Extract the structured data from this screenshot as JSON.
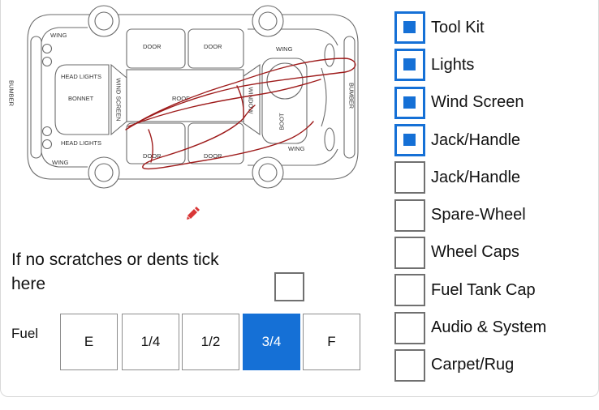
{
  "car_diagram": {
    "labels": {
      "bumper_front": "BUMBER",
      "bumper_rear": "BUMBER",
      "wing_front_top": "WING",
      "wing_front_bottom": "WING",
      "wing_rear_top": "WING",
      "wing_rear_bottom": "WING",
      "head_lights_top": "HEAD LIGHTS",
      "head_lights_bottom": "HEAD LIGHTS",
      "bonnet": "BONNET",
      "wind_screen": "WIND SCREEN",
      "door_front_top": "DOOR",
      "door_rear_top": "DOOR",
      "door_front_bottom": "DOOR",
      "door_rear_bottom": "DOOR",
      "roof": "ROOF",
      "window": "WINDOW",
      "boot": "BOOT"
    }
  },
  "toolbar": {
    "edit_icon": "pencil-icon"
  },
  "no_damage": {
    "label": "If no scratches or dents tick here",
    "checked": false
  },
  "fuel": {
    "label": "Fuel",
    "options": [
      "E",
      "1/4",
      "1/2",
      "3/4",
      "F"
    ],
    "selected": "3/4"
  },
  "checklist": {
    "items": [
      {
        "label": "Tool Kit",
        "checked": true
      },
      {
        "label": "Lights",
        "checked": true
      },
      {
        "label": "Wind Screen",
        "checked": true
      },
      {
        "label": "Jack/Handle",
        "checked": true
      },
      {
        "label": "Jack/Handle",
        "checked": false
      },
      {
        "label": "Spare-Wheel",
        "checked": false
      },
      {
        "label": "Wheel Caps",
        "checked": false
      },
      {
        "label": "Fuel Tank Cap",
        "checked": false
      },
      {
        "label": "Audio & System",
        "checked": false
      },
      {
        "label": "Carpet/Rug",
        "checked": false
      }
    ]
  },
  "colors": {
    "accent": "#1570d6",
    "marking": "#9e1b1b",
    "edit_icon": "#d93636",
    "diagram_stroke": "#6b6b6b",
    "checkbox_border": "#707070",
    "card_border": "#d9d9d9"
  }
}
